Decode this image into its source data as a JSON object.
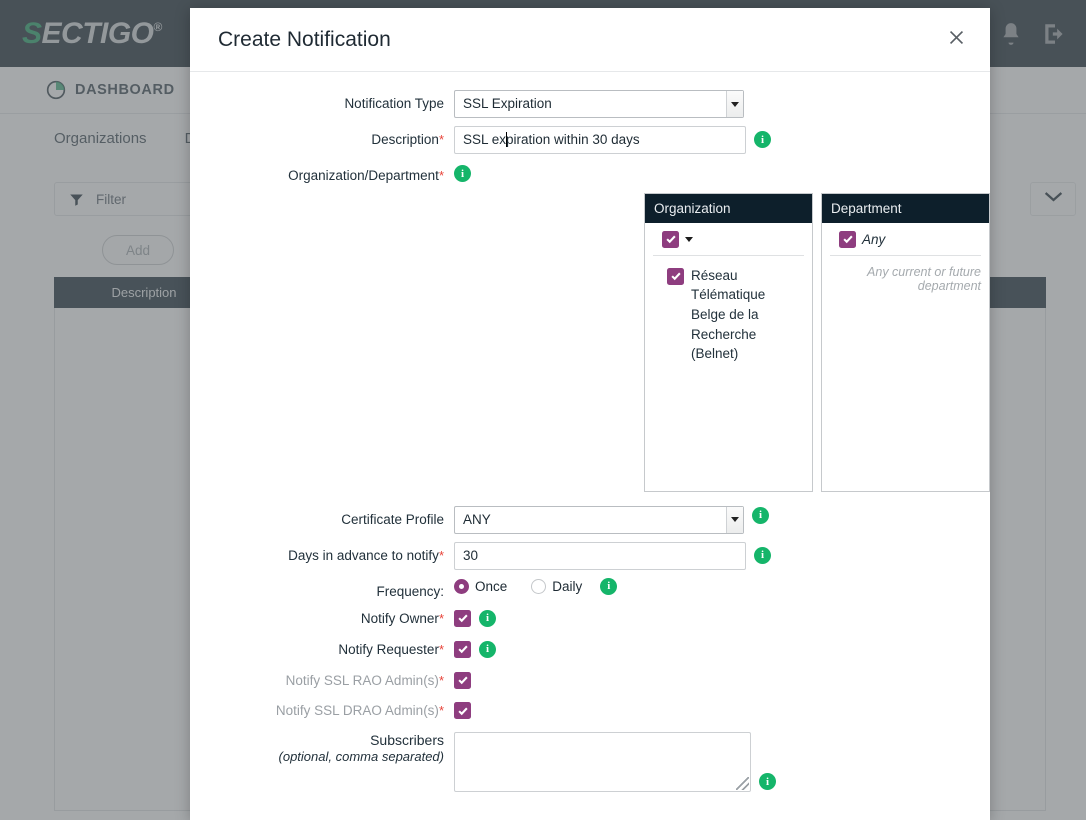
{
  "app": {
    "brand_s": "S",
    "brand_rest": "ECTIGO",
    "brand_reg": "®",
    "dashboard_label": "DASHBOARD",
    "tabs": [
      "Organizations",
      "Domains"
    ],
    "filter_placeholder": "Filter",
    "add_label": "Add",
    "table_headers": [
      "Description"
    ],
    "icons": {
      "chat": "chat-icon",
      "bell": "bell-icon",
      "logout": "logout-icon",
      "pie": "pie-chart-icon",
      "funnel": "funnel-icon",
      "chevron": "chevron-down-icon"
    }
  },
  "modal": {
    "title": "Create Notification",
    "close_label": "×",
    "notification_type": {
      "label": "Notification Type",
      "value": "SSL Expiration"
    },
    "description": {
      "label": "Description",
      "required": "*",
      "value_before_caret": "SSL ex",
      "value_after_caret": "piration within 30 days",
      "full_value": "SSL expiration within 30 days"
    },
    "org_dept": {
      "label": "Organization/Department",
      "required": "*"
    },
    "organization_panel": {
      "header": "Organization",
      "root_checked": true,
      "items": [
        {
          "label": "Réseau Télématique Belge de la Recherche (Belnet)",
          "checked": true
        }
      ]
    },
    "department_panel": {
      "header": "Department",
      "any_label": "Any",
      "any_checked": true,
      "note": "Any current or future department"
    },
    "certificate_profile": {
      "label": "Certificate Profile",
      "value": "ANY"
    },
    "days_in_advance": {
      "label": "Days in advance to notify",
      "required": "*",
      "value": "30"
    },
    "frequency": {
      "label": "Frequency:",
      "options": [
        {
          "label": "Once",
          "selected": true
        },
        {
          "label": "Daily",
          "selected": false
        }
      ]
    },
    "notify_owner": {
      "label": "Notify Owner",
      "required": "*",
      "checked": true
    },
    "notify_requester": {
      "label": "Notify Requester",
      "required": "*",
      "checked": true
    },
    "notify_rao": {
      "label": "Notify SSL RAO Admin(s)",
      "required": "*",
      "checked": true,
      "disabled": true
    },
    "notify_drao": {
      "label": "Notify SSL DRAO Admin(s)",
      "required": "*",
      "checked": true,
      "disabled": true
    },
    "subscribers": {
      "label": "Subscribers",
      "sub_label": "(optional, comma separated)",
      "value": ""
    }
  },
  "colors": {
    "brand_green": "#139b5c",
    "dark_navy": "#0c1b26",
    "checkbox_purple": "#8e3d7f",
    "info_green": "#15b56a",
    "required_red": "#e8443a"
  }
}
